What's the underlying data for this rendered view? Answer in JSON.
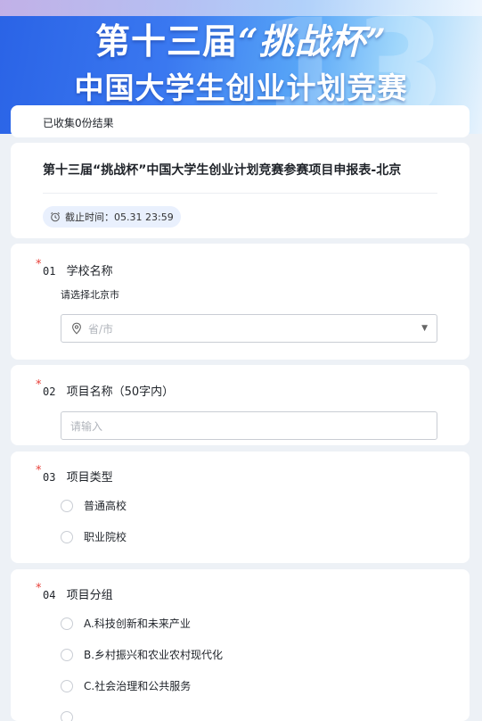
{
  "banner": {
    "line1_pre": "第十三届",
    "line1_quote": "“挑战杯”",
    "line2": "中国大学生创业计划竞赛",
    "deco": "13"
  },
  "summary": {
    "collected_text": "已收集0份结果"
  },
  "form": {
    "title": "第十三届“挑战杯”中国大学生创业计划竞赛参赛项目申报表-北京",
    "deadline": "截止时间：05.31 23:59"
  },
  "questions": [
    {
      "required": "*",
      "number": "01",
      "label": "学校名称",
      "description": "请选择北京市",
      "select_placeholder": "省/市"
    },
    {
      "required": "*",
      "number": "02",
      "label": "项目名称（50字内）",
      "input_placeholder": "请输入"
    },
    {
      "required": "*",
      "number": "03",
      "label": "项目类型",
      "options": [
        "普通高校",
        "职业院校"
      ]
    },
    {
      "required": "*",
      "number": "04",
      "label": "项目分组",
      "options": [
        "A.科技创新和未来产业",
        "B.乡村振兴和农业农村现代化",
        "C.社会治理和公共服务"
      ]
    }
  ],
  "colors": {
    "accent": "#3370ff",
    "required": "#e8413a",
    "page_bg": "#edf1f6"
  }
}
